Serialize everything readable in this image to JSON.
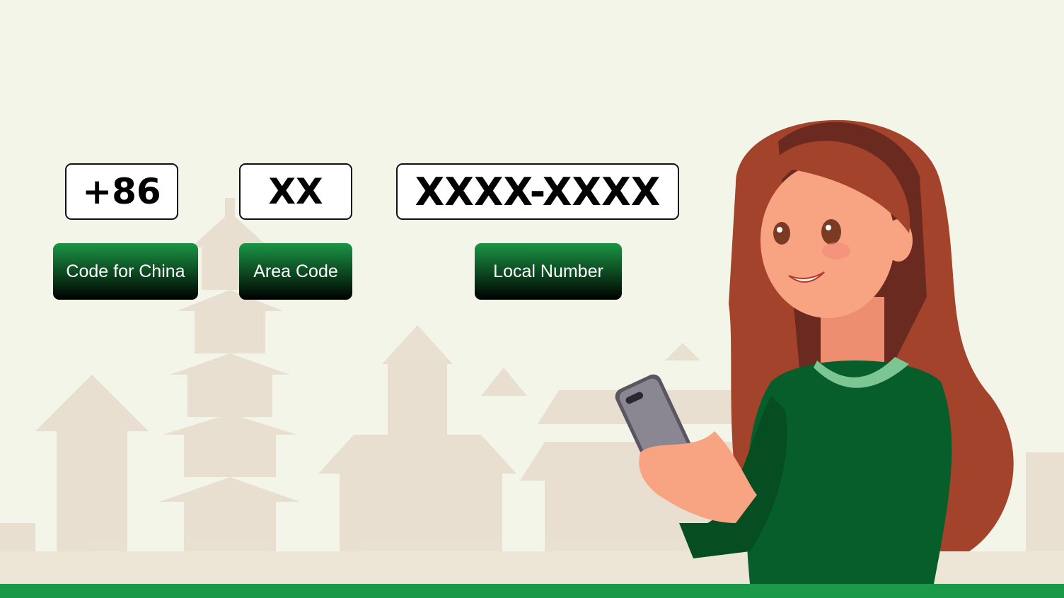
{
  "segments": [
    {
      "value": "+86",
      "label": "Code for China"
    },
    {
      "value": "XX",
      "label": "Area Code"
    },
    {
      "value": "XXXX-XXXX",
      "label": "Local Number"
    }
  ],
  "colors": {
    "background": "#f4f5e9",
    "label_green": "#1b9545",
    "bottom_bar": "#1a9a48",
    "buildings": "#e3d6c8"
  },
  "illustration": {
    "subject": "woman-holding-phone",
    "backdrop": "chinese-pagodas"
  }
}
